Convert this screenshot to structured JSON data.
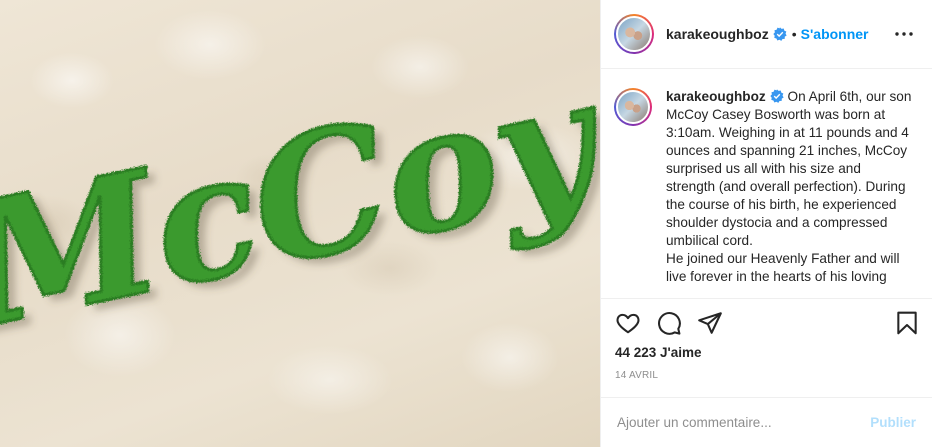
{
  "post": {
    "author": {
      "username": "karakeoughboz",
      "verified": true,
      "follow_label": "S'abonner",
      "separator": "•"
    },
    "image": {
      "sign_text": "McCoy",
      "colors": {
        "moss": "#3a9a2e",
        "rug": "#ebe2d2"
      }
    },
    "caption": {
      "username": "karakeoughboz",
      "text": "On April 6th, our son McCoy Casey Bosworth was born at 3:10am. Weighing in at 11 pounds and 4 ounces and spanning 21 inches, McCoy surprised us all with his size and strength (and overall perfection). During the course of his birth, he experienced shoulder dystocia and a compressed umbilical cord.",
      "text2": "He joined our Heavenly Father and will live forever in the hearts of his loving"
    },
    "actions": {
      "like_icon": "heart-icon",
      "comment_icon": "comment-icon",
      "share_icon": "paper-plane-icon",
      "save_icon": "bookmark-icon",
      "more_icon": "more-options-icon"
    },
    "likes_label": "44 223 J'aime",
    "date": "14 AVRIL",
    "comment": {
      "placeholder": "Ajouter un commentaire...",
      "publish_label": "Publier"
    },
    "colors": {
      "accent": "#0095f6",
      "verified": "#3897f0",
      "muted": "#8e8e8e",
      "publish_disabled": "#b2dffc"
    }
  }
}
